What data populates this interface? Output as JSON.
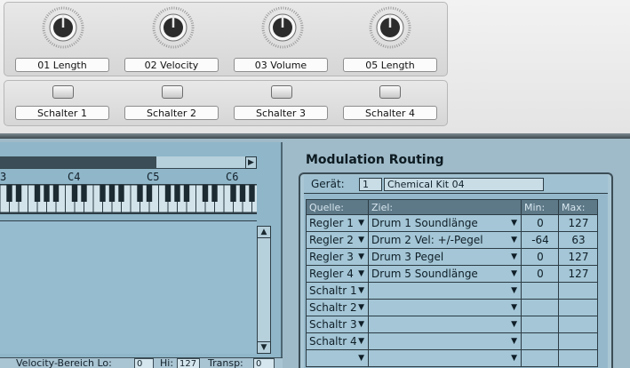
{
  "knobs": [
    {
      "label": "01 Length"
    },
    {
      "label": "02 Velocity"
    },
    {
      "label": "03 Volume"
    },
    {
      "label": "05 Length"
    }
  ],
  "switches": [
    {
      "label": "Schalter 1"
    },
    {
      "label": "Schalter 2"
    },
    {
      "label": "Schalter 3"
    },
    {
      "label": "Schalter 4"
    }
  ],
  "keyboard": {
    "note_labels": [
      "3",
      "C4",
      "C5",
      "C6"
    ]
  },
  "bottom_bar": {
    "velocity_label": "Velocity-Bereich Lo:",
    "lo_value": "0",
    "hi_label": "Hi:",
    "hi_value": "127",
    "transp_label": "Transp:",
    "transp_value": "0"
  },
  "modulation": {
    "title": "Modulation Routing",
    "device_label": "Gerät:",
    "device_number": "1",
    "device_name": "Chemical Kit 04",
    "headers": {
      "source": "Quelle:",
      "target": "Ziel:",
      "min": "Min:",
      "max": "Max:"
    },
    "rows": [
      {
        "source": "Regler 1",
        "target": "Drum 1 Soundlänge",
        "min": "0",
        "max": "127"
      },
      {
        "source": "Regler 2",
        "target": "Drum 2 Vel: +/-Pegel",
        "min": "-64",
        "max": "63"
      },
      {
        "source": "Regler 3",
        "target": "Drum 3 Pegel",
        "min": "0",
        "max": "127"
      },
      {
        "source": "Regler 4",
        "target": "Drum 5 Soundlänge",
        "min": "0",
        "max": "127"
      },
      {
        "source": "Schaltr 1",
        "target": "",
        "min": "",
        "max": ""
      },
      {
        "source": "Schaltr 2",
        "target": "",
        "min": "",
        "max": ""
      },
      {
        "source": "Schaltr 3",
        "target": "",
        "min": "",
        "max": ""
      },
      {
        "source": "Schaltr 4",
        "target": "",
        "min": "",
        "max": ""
      },
      {
        "source": "",
        "target": "",
        "min": "",
        "max": ""
      }
    ]
  }
}
